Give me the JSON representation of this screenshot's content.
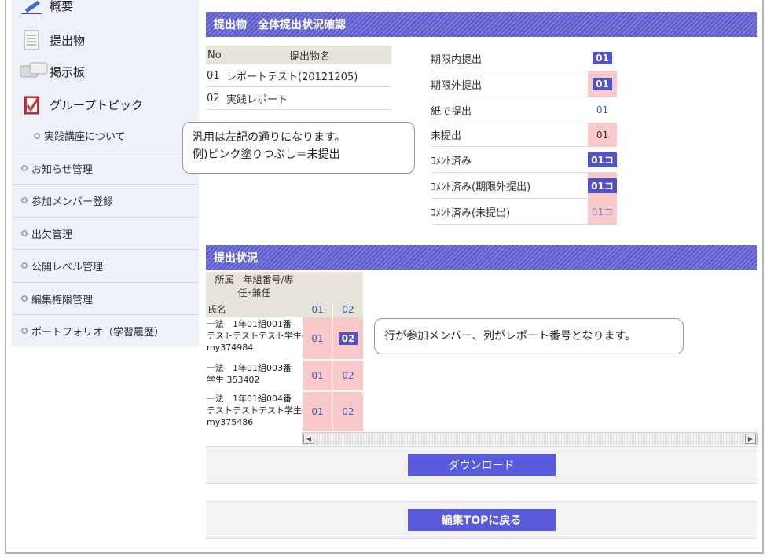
{
  "sidebar": {
    "overview": "概要",
    "submission": "提出物",
    "board": "掲示板",
    "group_topic": "グループトピック",
    "sub_practice": "実践講座について",
    "items": [
      "お知らせ管理",
      "参加メンバー登録",
      "出欠管理",
      "公開レベル管理",
      "編集権限管理",
      "ポートフォリオ（学習履歴）"
    ]
  },
  "panel1": {
    "title": "提出物　全体提出状況確認",
    "cols": [
      "No",
      "提出物名"
    ],
    "rows": [
      {
        "no": "01",
        "name": "レポートテスト(20121205)"
      },
      {
        "no": "02",
        "name": "実践レポート"
      }
    ]
  },
  "legend": [
    {
      "label": "期限内提出",
      "value": "01"
    },
    {
      "label": "期限外提出",
      "value": "01"
    },
    {
      "label": "紙で提出",
      "value": "01"
    },
    {
      "label": "未提出",
      "value": "01"
    },
    {
      "label": "ｺﾒﾝﾄ済み",
      "value": "01コ"
    },
    {
      "label": "ｺﾒﾝﾄ済み(期限外提出)",
      "value": "01コ"
    },
    {
      "label": "ｺﾒﾝﾄ済み(未提出)",
      "value": "01コ"
    }
  ],
  "bubble1": {
    "line1": "汎用は左記の通りになります。",
    "line2": "例)ピンク塗りつぶし＝未提出"
  },
  "bubble2": "行が参加メンバー、列がレポート番号となります。",
  "panel2": {
    "title": "提出状況",
    "head_line1": "所属　年組番号/専",
    "head_line2": "任･兼任",
    "name_label": "氏名",
    "cols": [
      "01",
      "02"
    ],
    "members": [
      {
        "l1": "一法　1年01組001番",
        "l2": "テストテストテスト学生d",
        "l3": "my374984",
        "c1": "01",
        "c2": "02"
      },
      {
        "l1": "一法　1年01組003番",
        "l2": "学生 353402",
        "l3": "",
        "c1": "01",
        "c2": "02"
      },
      {
        "l1": "一法　1年01組004番",
        "l2": "テストテストテスト学生d",
        "l3": "my375486",
        "c1": "01",
        "c2": "02"
      }
    ]
  },
  "buttons": {
    "download": "ダウンロード",
    "back": "編集TOPに戻る"
  }
}
